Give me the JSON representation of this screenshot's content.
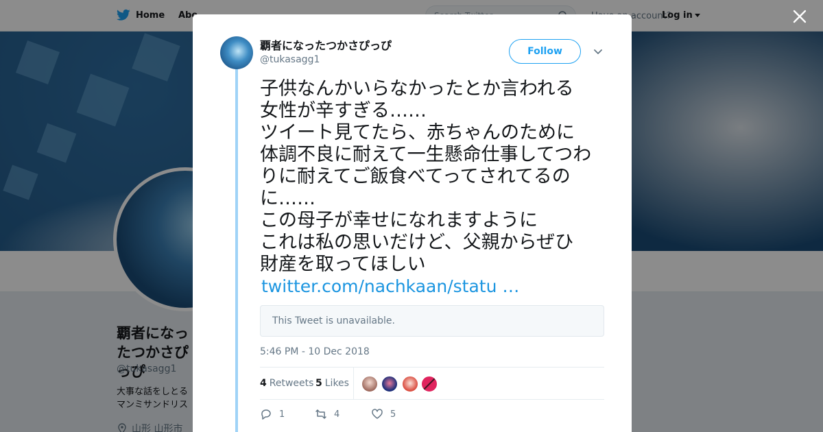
{
  "nav": {
    "home_label": "Home",
    "about_label": "Abo",
    "search_placeholder": "Search Twitter",
    "account_prompt": "Have an account?",
    "login_label": "Log in"
  },
  "profile": {
    "name": "覇者になったつかさぴっぴ",
    "handle": "@tukasagg1",
    "bio_lines": [
      "大事な話をしとる",
      "マンミサンドリス"
    ],
    "location": "山形 山形市"
  },
  "tweet": {
    "author_name": "覇者になったつかさぴっぴ",
    "author_handle": "@tukasagg1",
    "follow_label": "Follow",
    "text_lines": [
      "子供なんかいらなかったとか言われる",
      "女性が辛すぎる……",
      "ツイート見てたら、赤ちゃんのために",
      "体調不良に耐えて一生懸命仕事してつわ",
      "りに耐えてご飯食べてってされてるの",
      "に……",
      "この母子が幸せになれますように",
      "これは私の思いだけど、父親からぜひ",
      "財産を取ってほしい"
    ],
    "link": "twitter.com/nachkaan/statu …",
    "quoted_unavailable": "This Tweet is unavailable.",
    "timestamp": "5:46 PM - 10 Dec 2018",
    "retweets_count": "4",
    "retweets_label": "Retweets",
    "likes_count": "5",
    "likes_label": "Likes",
    "replies": "1",
    "retweets_action": "4",
    "likes_action": "5"
  },
  "colors": {
    "accent": "#1da1f2",
    "link": "#1b95e0",
    "thread_line": "#9fd3f7"
  }
}
